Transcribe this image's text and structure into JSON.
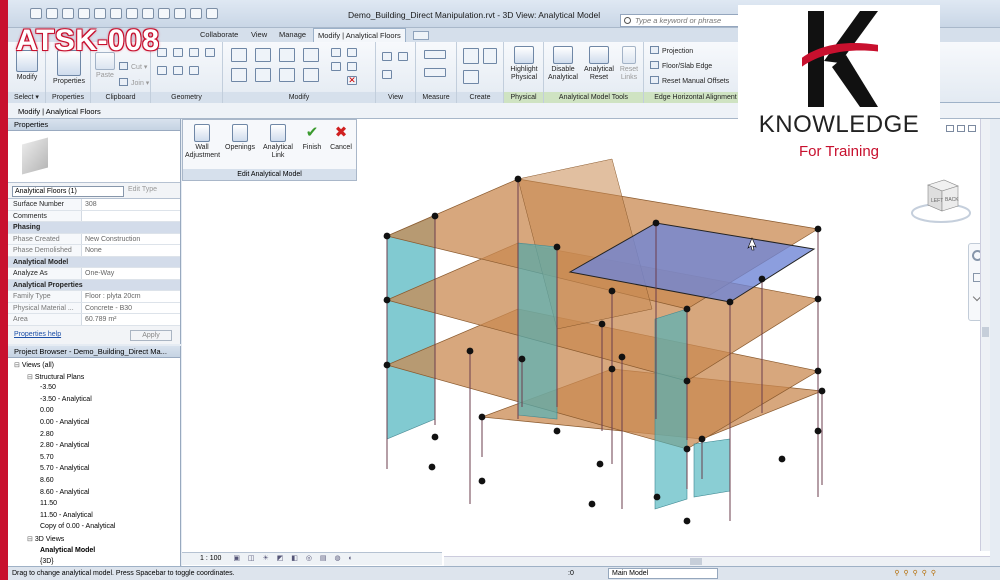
{
  "window": {
    "title": "Demo_Building_Direct Manipulation.rvt - 3D View: Analytical Model",
    "search_placeholder": "Type a keyword or phrase"
  },
  "tabs": [
    {
      "label": "Collaborate"
    },
    {
      "label": "View"
    },
    {
      "label": "Manage"
    },
    {
      "label": "Modify | Analytical Floors",
      "active": true
    }
  ],
  "ribbon": {
    "select": {
      "modify": "Modify",
      "label": "Select ▾"
    },
    "properties": {
      "btn": "Properties",
      "label": "Properties"
    },
    "clipboard": {
      "paste": "Paste",
      "cut": "Cut ▾",
      "join": "Join ▾",
      "label": "Clipboard"
    },
    "geometry": {
      "label": "Geometry"
    },
    "modify": {
      "label": "Modify"
    },
    "view": {
      "label": "View"
    },
    "measure": {
      "label": "Measure"
    },
    "create": {
      "label": "Create"
    },
    "physical": {
      "highlight": "Highlight Physical",
      "label": "Physical"
    },
    "amt": {
      "disable": "Disable Analytical",
      "reset": "Analytical Reset",
      "links": "Reset Links",
      "label": "Analytical Model Tools"
    },
    "eha": {
      "projection": "Projection",
      "floor_slab": "Floor/Slab Edge",
      "reset_offsets": "Reset Manual Offsets",
      "label": "Edge Horizontal Alignment"
    }
  },
  "options_bar": {
    "text": "Modify | Analytical Floors"
  },
  "properties": {
    "title": "Properties",
    "type_selector": "Analytical Floors (1)",
    "edit_type": "Edit Type",
    "rows": [
      {
        "k": "Surface Number",
        "v": "308"
      },
      {
        "k": "Comments",
        "v": ""
      },
      {
        "k": "Phasing",
        "section": true
      },
      {
        "k": "Phase Created",
        "v": "New Construction",
        "ro": true
      },
      {
        "k": "Phase Demolished",
        "v": "None",
        "ro": true
      },
      {
        "k": "Analytical Model",
        "section": true
      },
      {
        "k": "Analyze As",
        "v": "One-Way"
      },
      {
        "k": "Analytical Properties",
        "section": true
      },
      {
        "k": "Family Type",
        "v": "Floor : plyta 20cm",
        "ro": true
      },
      {
        "k": "Physical Material ...",
        "v": "Concrete - B30",
        "ro": true
      },
      {
        "k": "Area",
        "v": "60.789 m²",
        "ro": true
      }
    ],
    "help": "Properties help",
    "apply": "Apply"
  },
  "browser": {
    "title": "Project Browser - Demo_Building_Direct Ma...",
    "items": [
      {
        "label": "Views (all)",
        "lvl": 0,
        "exp": true
      },
      {
        "label": "Structural Plans",
        "lvl": 1,
        "exp": true
      },
      {
        "label": "-3.50",
        "lvl": 2
      },
      {
        "label": "-3.50 - Analytical",
        "lvl": 2
      },
      {
        "label": "0.00",
        "lvl": 2
      },
      {
        "label": "0.00 - Analytical",
        "lvl": 2
      },
      {
        "label": "2.80",
        "lvl": 2
      },
      {
        "label": "2.80 - Analytical",
        "lvl": 2
      },
      {
        "label": "5.70",
        "lvl": 2
      },
      {
        "label": "5.70 - Analytical",
        "lvl": 2
      },
      {
        "label": "8.60",
        "lvl": 2
      },
      {
        "label": "8.60 - Analytical",
        "lvl": 2
      },
      {
        "label": "11.50",
        "lvl": 2
      },
      {
        "label": "11.50 - Analytical",
        "lvl": 2
      },
      {
        "label": "Copy of 0.00 - Analytical",
        "lvl": 2
      },
      {
        "label": "3D Views",
        "lvl": 1,
        "exp": true
      },
      {
        "label": "Analytical Model",
        "lvl": 2,
        "bold": true
      },
      {
        "label": "{3D}",
        "lvl": 2
      }
    ]
  },
  "edit_panel": {
    "wall_adjustment": "Wall Adjustment",
    "openings": "Openings",
    "analytical_link": "Analytical Link",
    "finish": "Finish",
    "cancel": "Cancel",
    "label": "Edit Analytical Model"
  },
  "viewcube": {
    "face1": "LEFT",
    "face2": "BACK"
  },
  "view_control": {
    "scale": "1 : 100"
  },
  "status": {
    "text": "Drag to change analytical model. Press Spacebar to toggle coordinates.",
    "model": "Main Model",
    "count": ":0"
  },
  "overlay": {
    "badge": "ATSK-008",
    "logo_title": "KNOWLEDGE",
    "logo_sub": "For Training"
  },
  "colors": {
    "brand_red": "#c8102e",
    "orange_slab": "#c98a52",
    "teal_wall": "#4bb3bd",
    "blue_selected": "#6f86d6"
  }
}
